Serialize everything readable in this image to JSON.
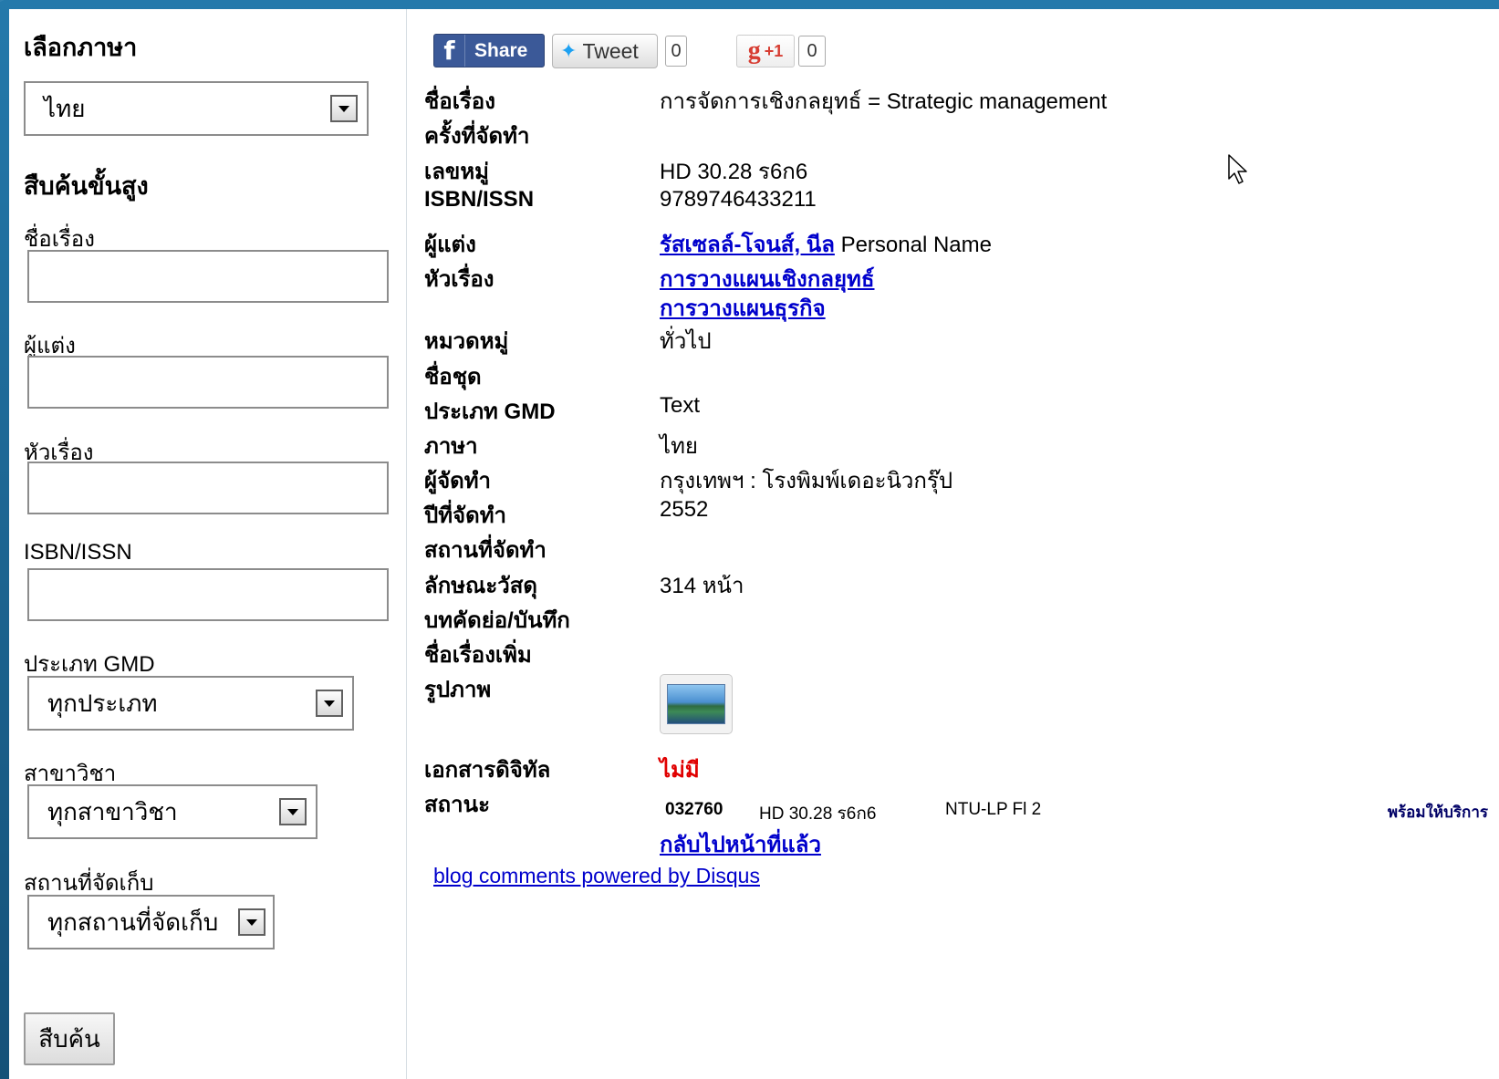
{
  "sidebar": {
    "language_heading": "เลือกภาษา",
    "language_value": "ไทย",
    "advanced_heading": "สืบค้นขั้นสูง",
    "title_label": "ชื่อเรื่อง",
    "author_label": "ผู้แต่ง",
    "subject_label": "หัวเรื่อง",
    "isbn_label": "ISBN/ISSN",
    "gmd_label": "ประเภท GMD",
    "gmd_value": "ทุกประเภท",
    "branch_label": "สาขาวิชา",
    "branch_value": "ทุกสาขาวิชา",
    "location_label": "สถานที่จัดเก็บ",
    "location_value": "ทุกสถานที่จัดเก็บ",
    "search_button": "สืบค้น"
  },
  "social": {
    "fb_share": "Share",
    "tweet": "Tweet",
    "tweet_count": "0",
    "gplus": "+1",
    "gplus_count": "0"
  },
  "record": {
    "title_label": "ชื่อเรื่อง",
    "title_value": "การจัดการเชิงกลยุทธ์ = Strategic management",
    "edition_label": "ครั้งที่จัดทำ",
    "callno_label": "เลขหมู่",
    "callno_value": "HD 30.28 ร6ก6",
    "isbn_label": "ISBN/ISSN",
    "isbn_value": "9789746433211",
    "author_label": "ผู้แต่ง",
    "author_link": "รัสเซลล์-โจนส์, นีล",
    "author_type": "Personal Name",
    "subject_label": "หัวเรื่อง",
    "subject_1": "การวางแผนเชิงกลยุทธ์",
    "subject_2": "การวางแผนธุรกิจ",
    "category_label": "หมวดหมู่",
    "category_value": "ทั่วไป",
    "series_label": "ชื่อชุด",
    "gmd_label": "ประเภท GMD",
    "gmd_value": "Text",
    "language_label": "ภาษา",
    "language_value": "ไทย",
    "publisher_label": "ผู้จัดทำ",
    "publisher_value": "กรุงเทพฯ : โรงพิมพ์เดอะนิวกรุ๊ป",
    "year_label": "ปีที่จัดทำ",
    "year_value": "2552",
    "place_label": "สถานที่จัดทำ",
    "physical_label": "ลักษณะวัสดุ",
    "physical_value": "314 หน้า",
    "abstract_label": "บทคัดย่อ/บันทึก",
    "addtitle_label": "ชื่อเรื่องเพิ่ม",
    "image_label": "รูปภาพ",
    "digital_label": "เอกสารดิจิทัล",
    "digital_value": "ไม่มี",
    "status_label": "สถานะ",
    "status_barcode": "032760",
    "status_callno": "HD 30.28 ร6ก6",
    "status_location": "NTU-LP Fl 2",
    "status_availability": "พร้อมให้บริการ",
    "back_link": "กลับไปหน้าที่แล้ว",
    "disqus_link": "blog comments powered by Disqus"
  }
}
